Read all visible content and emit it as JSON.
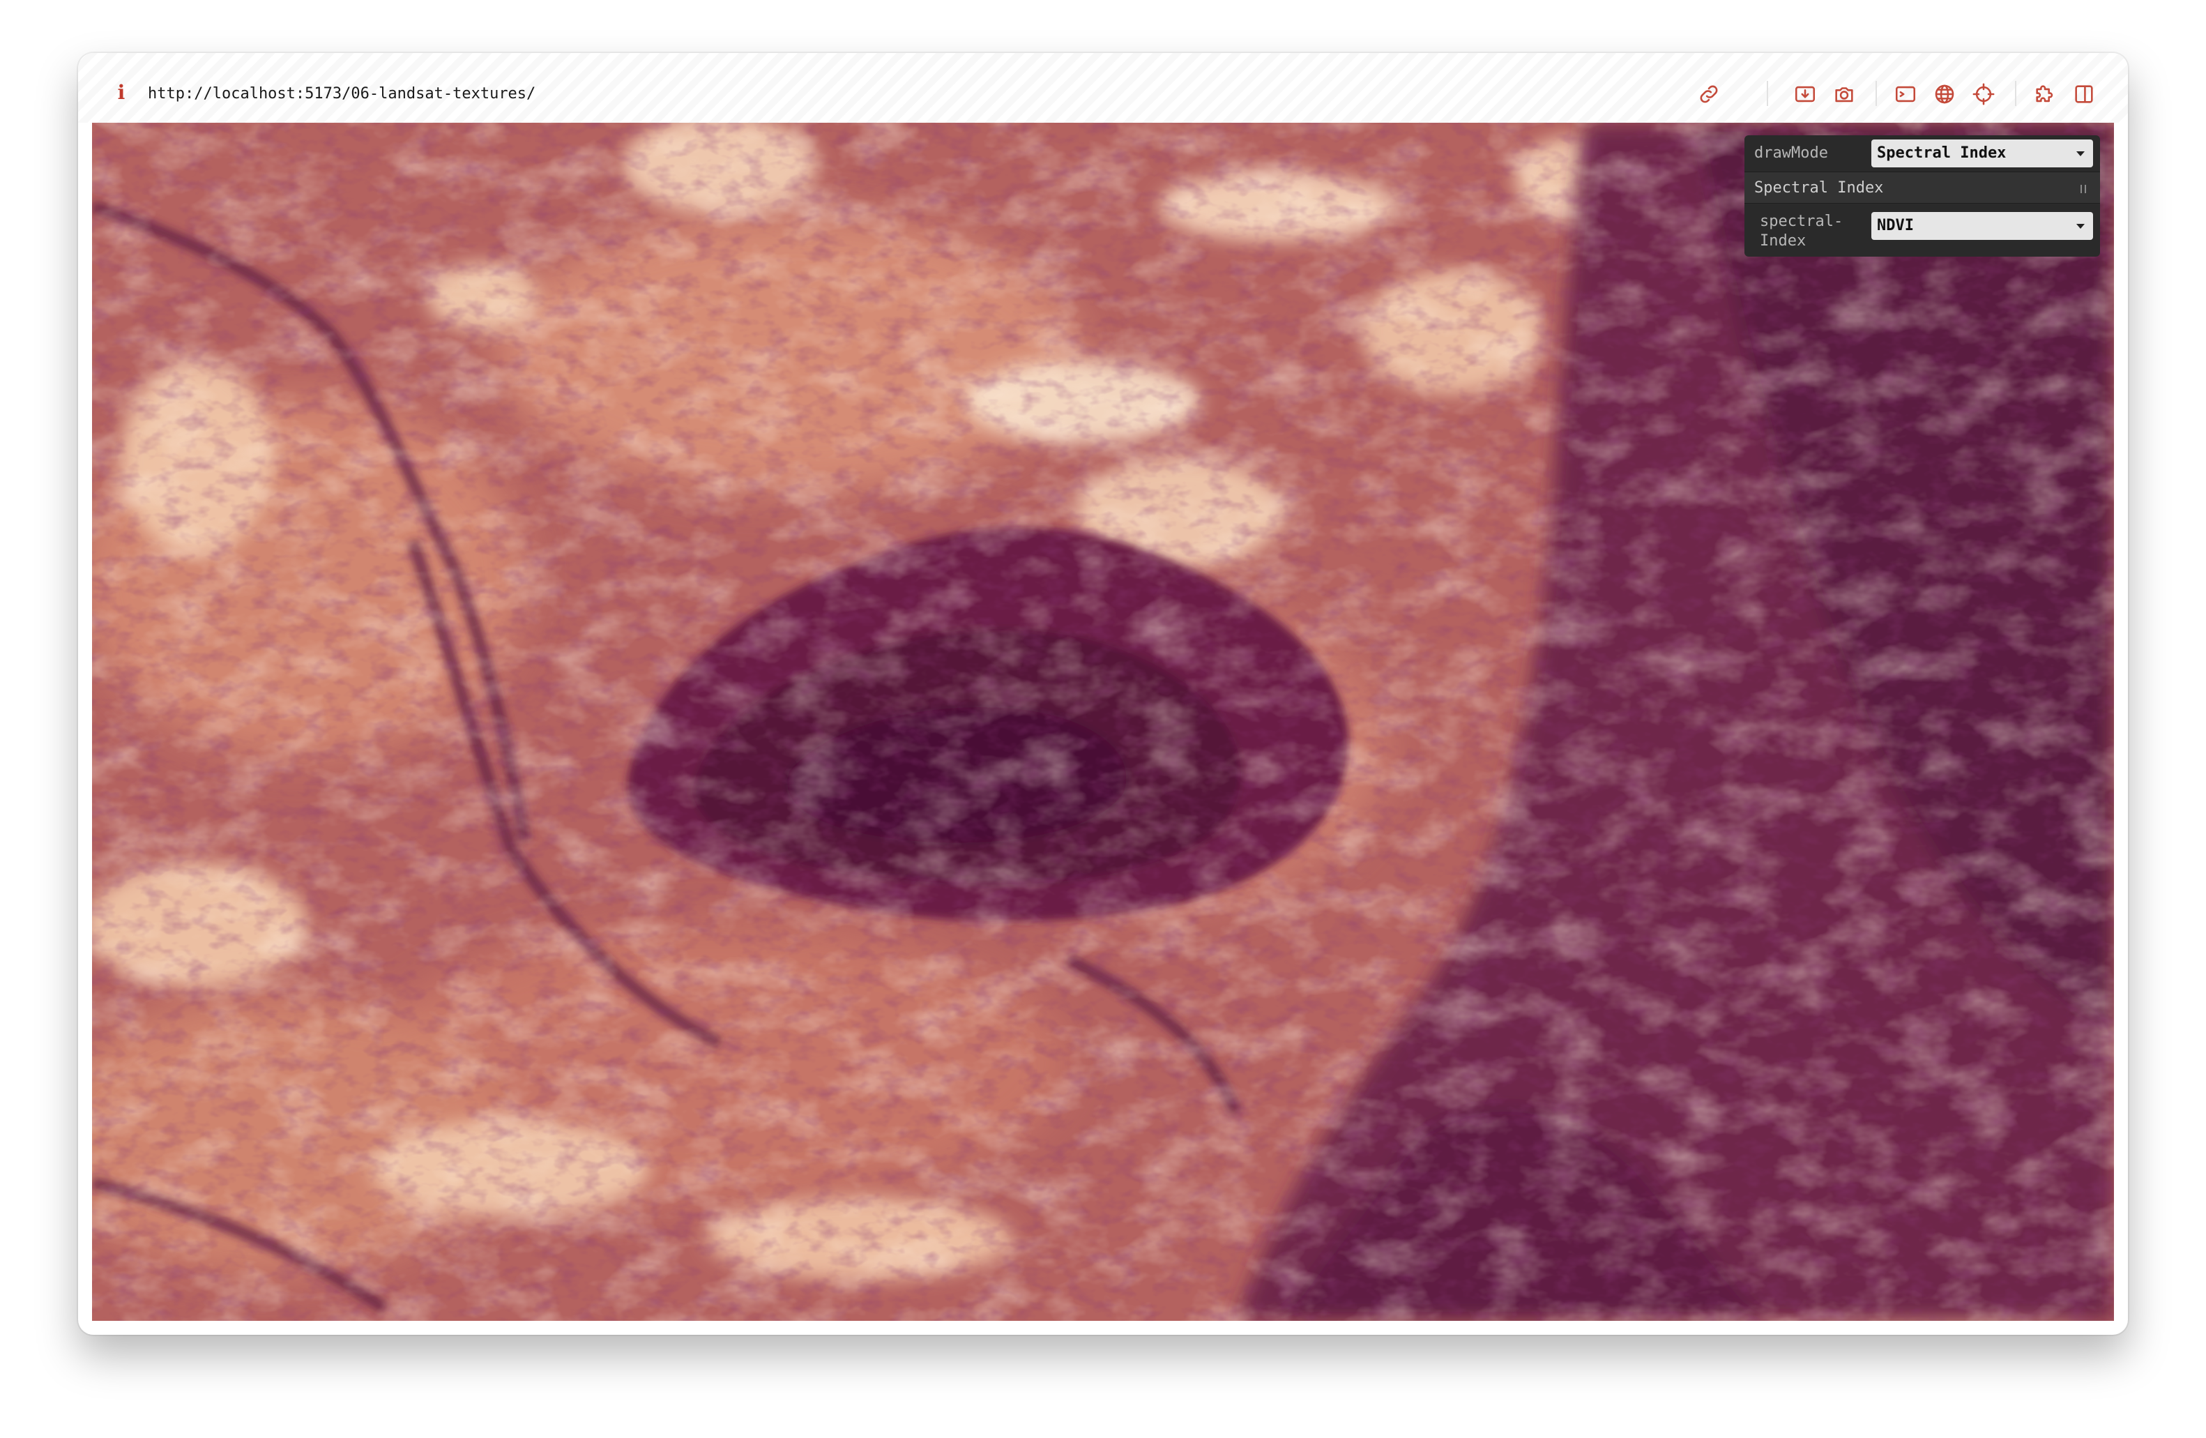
{
  "browser": {
    "url": "http://localhost:5173/06-landsat-textures/",
    "info_icon": "info-icon",
    "toolbar_icons": [
      "link-icon",
      "download-icon",
      "camera-icon",
      "terminal-icon",
      "globe-icon",
      "crosshair-icon",
      "extensions-icon",
      "split-view-icon"
    ]
  },
  "gui": {
    "draw_mode": {
      "label": "drawMode",
      "value": "Spectral Index"
    },
    "folder": {
      "title": "Spectral Index"
    },
    "spectral_index": {
      "label_line1": "spectral-",
      "label_line2": "Index",
      "value": "NDVI"
    }
  },
  "colors": {
    "panel_bg": "#2a2a2a",
    "select_bg": "#e6e6e6",
    "info_accent": "#c0392b",
    "terrain_dark": "#4a1238",
    "terrain_mid": "#a0505a",
    "terrain_light": "#f3d3bb"
  }
}
